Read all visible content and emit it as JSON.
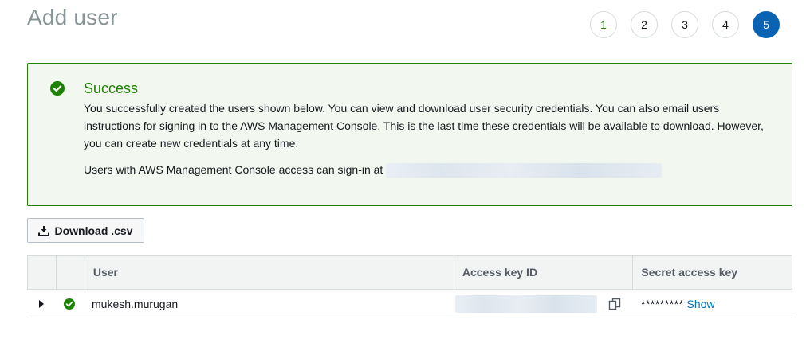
{
  "header": {
    "title": "Add user"
  },
  "steps": [
    "1",
    "2",
    "3",
    "4",
    "5"
  ],
  "alert": {
    "title": "Success",
    "body": "You successfully created the users shown below. You can view and download user security credentials. You can also email users instructions for signing in to the AWS Management Console. This is the last time these credentials will be available to download. However, you can create new credentials at any time.",
    "signin_text": "Users with AWS Management Console access can sign-in at"
  },
  "toolbar": {
    "download_label": "Download .csv"
  },
  "table": {
    "columns": [
      "User",
      "Access key ID",
      "Secret access key"
    ],
    "rows": [
      {
        "user": "mukesh.murugan",
        "secret_masked": "*********",
        "show_label": "Show"
      }
    ]
  },
  "colors": {
    "success": "#1d8102",
    "primary": "#0a62b2",
    "link": "#0073bb"
  }
}
